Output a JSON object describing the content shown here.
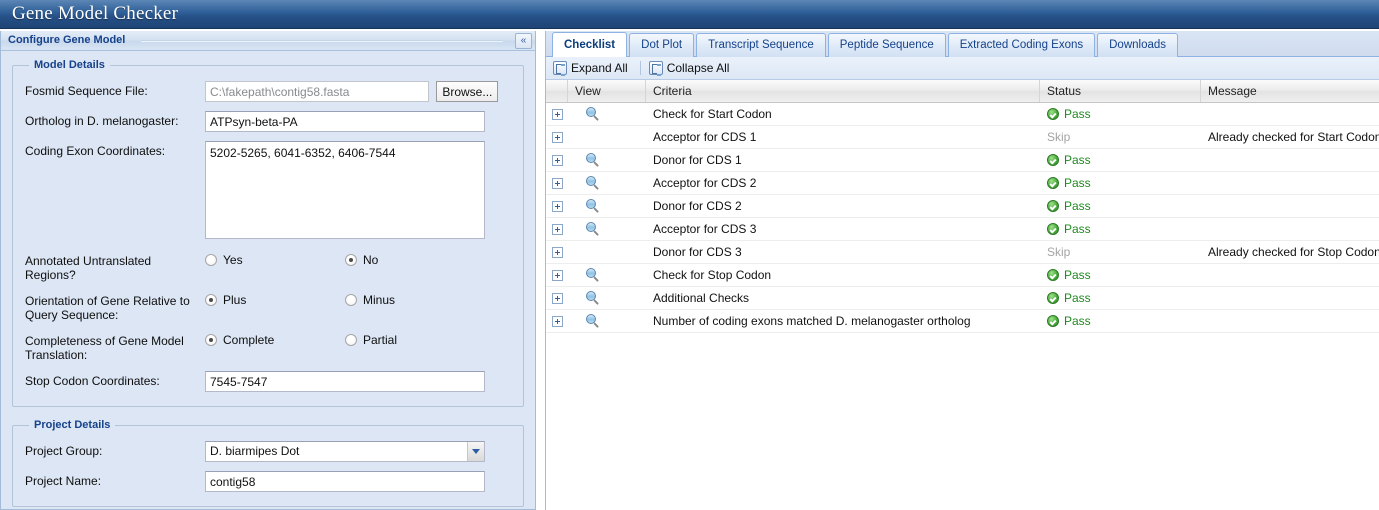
{
  "app": {
    "title": "Gene Model Checker"
  },
  "left_panel": {
    "header_title": "Configure Gene Model",
    "collapse_icon": "double-chevron-left-icon",
    "collapse_glyph": "«",
    "model_details": {
      "legend": "Model Details",
      "fields": {
        "fosmid_label": "Fosmid Sequence File:",
        "fosmid_value": "C:\\fakepath\\contig58.fasta",
        "browse_label": "Browse...",
        "ortholog_label": "Ortholog in D. melanogaster:",
        "ortholog_value": "ATPsyn-beta-PA",
        "exons_label": "Coding Exon Coordinates:",
        "exons_value": "5202-5265, 6041-6352, 6406-7544",
        "utr_label": "Annotated Untranslated Regions?",
        "utr_options": [
          "Yes",
          "No"
        ],
        "utr_selected": "No",
        "orientation_label": "Orientation of Gene Relative to Query Sequence:",
        "orientation_options": [
          "Plus",
          "Minus"
        ],
        "orientation_selected": "Plus",
        "completeness_label": "Completeness of Gene Model Translation:",
        "completeness_options": [
          "Complete",
          "Partial"
        ],
        "completeness_selected": "Complete",
        "stop_codon_label": "Stop Codon Coordinates:",
        "stop_codon_value": "7545-7547"
      }
    },
    "project_details": {
      "legend": "Project Details",
      "fields": {
        "group_label": "Project Group:",
        "group_value": "D. biarmipes Dot",
        "group_arrow_icon": "chevron-down-icon",
        "name_label": "Project Name:",
        "name_value": "contig58"
      }
    }
  },
  "right_panel": {
    "tabs": [
      {
        "label": "Checklist",
        "active": true
      },
      {
        "label": "Dot Plot",
        "active": false
      },
      {
        "label": "Transcript Sequence",
        "active": false
      },
      {
        "label": "Peptide Sequence",
        "active": false
      },
      {
        "label": "Extracted Coding Exons",
        "active": false
      },
      {
        "label": "Downloads",
        "active": false
      }
    ],
    "toolbar": {
      "expand_all_label": "Expand All",
      "expand_all_icon": "expand-tree-icon",
      "collapse_all_label": "Collapse All",
      "collapse_all_icon": "collapse-tree-icon"
    },
    "grid": {
      "columns": [
        "",
        "View",
        "Criteria",
        "Status",
        "Message"
      ],
      "rows": [
        {
          "expander": "plus-icon",
          "view": "magnifier-icon",
          "criteria": "Check for Start Codon",
          "status": "Pass",
          "message": ""
        },
        {
          "expander": "plus-icon",
          "view": "",
          "criteria": "Acceptor for CDS 1",
          "status": "Skip",
          "message": "Already checked for Start Codon"
        },
        {
          "expander": "plus-icon",
          "view": "magnifier-icon",
          "criteria": "Donor for CDS 1",
          "status": "Pass",
          "message": ""
        },
        {
          "expander": "plus-icon",
          "view": "magnifier-icon",
          "criteria": "Acceptor for CDS 2",
          "status": "Pass",
          "message": ""
        },
        {
          "expander": "plus-icon",
          "view": "magnifier-icon",
          "criteria": "Donor for CDS 2",
          "status": "Pass",
          "message": ""
        },
        {
          "expander": "plus-icon",
          "view": "magnifier-icon",
          "criteria": "Acceptor for CDS 3",
          "status": "Pass",
          "message": ""
        },
        {
          "expander": "plus-icon",
          "view": "",
          "criteria": "Donor for CDS 3",
          "status": "Skip",
          "message": "Already checked for Stop Codon"
        },
        {
          "expander": "plus-icon",
          "view": "magnifier-icon",
          "criteria": "Check for Stop Codon",
          "status": "Pass",
          "message": ""
        },
        {
          "expander": "plus-icon",
          "view": "magnifier-icon",
          "criteria": "Additional Checks",
          "status": "Pass",
          "message": ""
        },
        {
          "expander": "plus-icon",
          "view": "magnifier-icon",
          "criteria": "Number of coding exons matched D. melanogaster ortholog",
          "status": "Pass",
          "message": ""
        }
      ]
    }
  },
  "colors": {
    "title_bar": "#31619a",
    "panel_bg": "#dce6f4",
    "accent": "#15428b",
    "pass_green": "#1f8a1f",
    "skip_grey": "#a4a4a4"
  }
}
